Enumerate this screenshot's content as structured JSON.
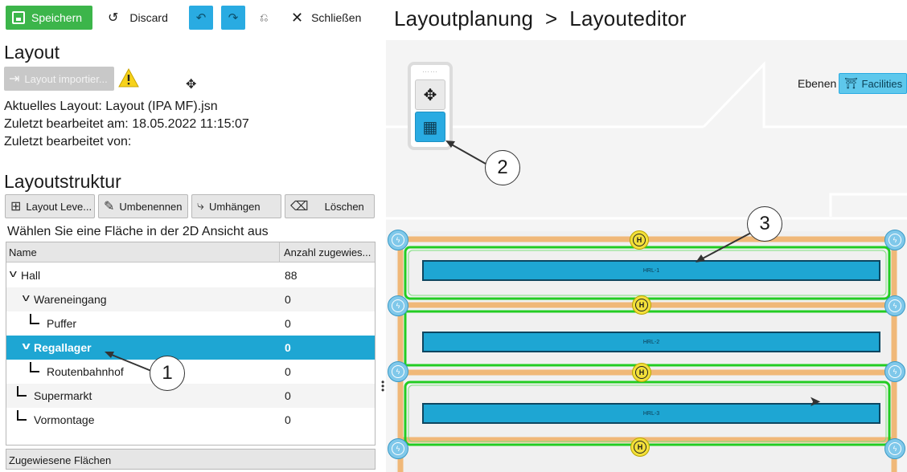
{
  "toolbar": {
    "save_label": "Speichern",
    "discard_label": "Discard",
    "close_label": "Schließen"
  },
  "layout_section": {
    "title": "Layout",
    "import_label": "Layout importier...",
    "current_layout": "Aktuelles Layout: Layout (IPA MF).jsn",
    "last_edited_at": "Zuletzt bearbeitet am: 18.05.2022 11:15:07",
    "last_edited_by": "Zuletzt bearbeitet von:"
  },
  "structure_section": {
    "title": "Layoutstruktur",
    "buttons": {
      "layout_level": "Layout Leve...",
      "rename": "Umbenennen",
      "rehang": "Umhängen",
      "delete": "Löschen"
    },
    "hint": "Wählen Sie eine Fläche in der 2D Ansicht aus",
    "columns": {
      "name": "Name",
      "count": "Anzahl zugewies..."
    },
    "rows": [
      {
        "name": "Hall",
        "value": "88"
      },
      {
        "name": "Wareneingang",
        "value": "0"
      },
      {
        "name": "Puffer",
        "value": "0"
      },
      {
        "name": "Regallager",
        "value": "0"
      },
      {
        "name": "Routenbahnhof",
        "value": "0"
      },
      {
        "name": "Supermarkt",
        "value": "0"
      },
      {
        "name": "Vormontage",
        "value": "0"
      }
    ],
    "assigned_header": "Zugewiesene Flächen"
  },
  "editor": {
    "breadcrumb": "Layoutplanung  >  Layouteditor",
    "layers_label": "Ebenen",
    "facilities_label": "Facilities",
    "racks": [
      "HRL-1",
      "HRL-2",
      "HRL-3"
    ],
    "node_label": "H",
    "callouts": [
      "1",
      "2",
      "3"
    ]
  },
  "colors": {
    "accent": "#29abe2",
    "save_green": "#3cb54a",
    "selection": "#1ea6d3",
    "path_green": "#22cc22",
    "path_orange": "#f0b878",
    "node_yellow": "#f3e03a"
  }
}
